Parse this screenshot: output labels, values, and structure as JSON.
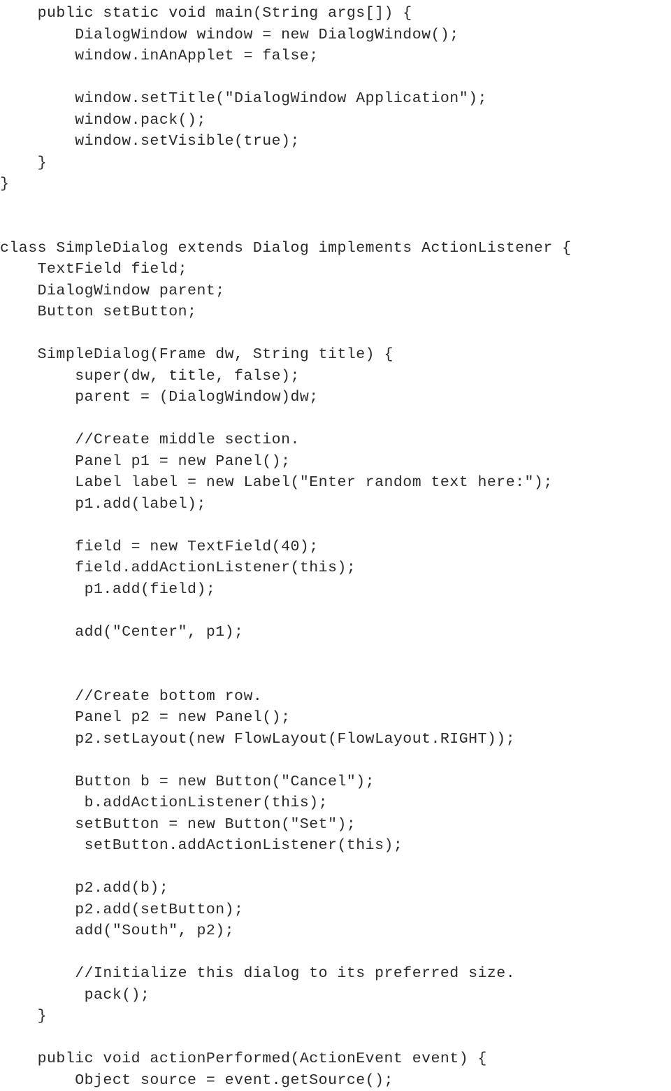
{
  "code": "    public static void main(String args[]) {\n        DialogWindow window = new DialogWindow();\n        window.inAnApplet = false;\n\n        window.setTitle(\"DialogWindow Application\");\n        window.pack();\n        window.setVisible(true);\n    }\n}\n\n\nclass SimpleDialog extends Dialog implements ActionListener {\n    TextField field;\n    DialogWindow parent;\n    Button setButton;\n\n    SimpleDialog(Frame dw, String title) {\n        super(dw, title, false);\n        parent = (DialogWindow)dw;\n\n        //Create middle section.\n        Panel p1 = new Panel();\n        Label label = new Label(\"Enter random text here:\");\n        p1.add(label);\n\n        field = new TextField(40);\n        field.addActionListener(this);\n         p1.add(field);\n\n        add(\"Center\", p1);\n\n\n        //Create bottom row.\n        Panel p2 = new Panel();\n        p2.setLayout(new FlowLayout(FlowLayout.RIGHT));\n\n        Button b = new Button(\"Cancel\");\n         b.addActionListener(this);\n        setButton = new Button(\"Set\");\n         setButton.addActionListener(this);\n\n        p2.add(b);\n        p2.add(setButton);\n        add(\"South\", p2);\n\n        //Initialize this dialog to its preferred size.\n         pack();\n    }\n\n    public void actionPerformed(ActionEvent event) {\n        Object source = event.getSource();"
}
